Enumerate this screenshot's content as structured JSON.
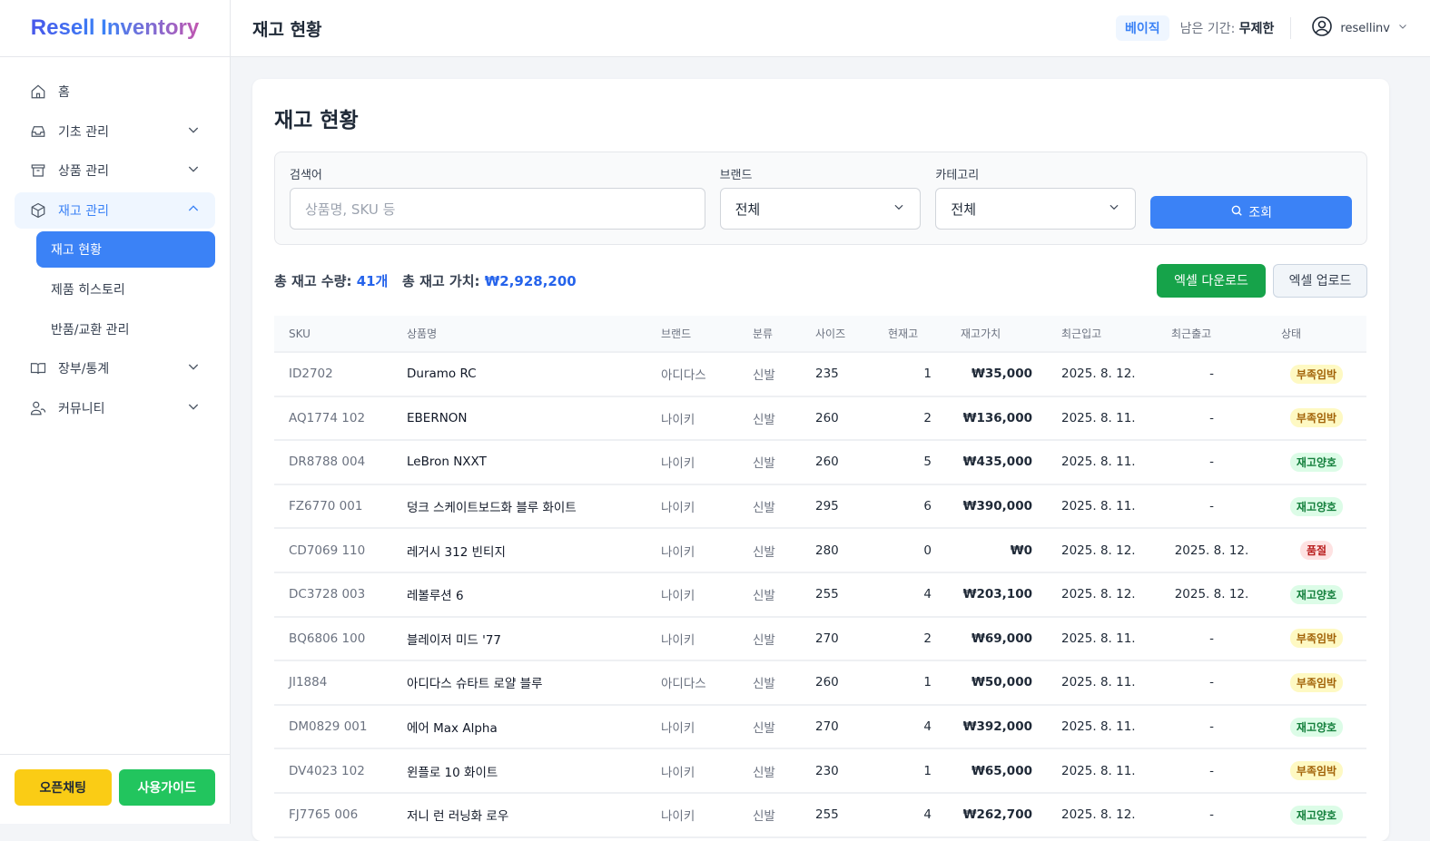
{
  "app": {
    "logo": "Resell Inventory"
  },
  "sidebar": {
    "items": [
      {
        "label": "홈",
        "icon": "home-icon"
      },
      {
        "label": "기초 관리",
        "icon": "inbox-icon"
      },
      {
        "label": "상품 관리",
        "icon": "archive-icon"
      },
      {
        "label": "재고 관리",
        "icon": "cube-icon"
      },
      {
        "label": "장부/통계",
        "icon": "book-icon"
      },
      {
        "label": "커뮤니티",
        "icon": "community-icon"
      }
    ],
    "subitems": [
      {
        "label": "재고 현황"
      },
      {
        "label": "제품 히스토리"
      },
      {
        "label": "반품/교환 관리"
      }
    ],
    "open_chat": "오픈채팅",
    "guide": "사용가이드"
  },
  "header": {
    "title": "재고 현황",
    "plan": "베이직",
    "remain_label": "남은 기간:",
    "remain_value": "무제한",
    "username": "resellinv"
  },
  "page": {
    "title": "재고 현황"
  },
  "filters": {
    "search_label": "검색어",
    "search_placeholder": "상품명, SKU 등",
    "brand_label": "브랜드",
    "brand_value": "전체",
    "category_label": "카테고리",
    "category_value": "전체",
    "search_button": "조회"
  },
  "summary": {
    "qty_label": "총 재고 수량:",
    "qty_value": "41개",
    "value_label": "총 재고 가치:",
    "value_value": "₩2,928,200",
    "download": "엑셀 다운로드",
    "upload": "엑셀 업로드"
  },
  "colors": {
    "primary": "#3b82f6",
    "green": "#16a34a",
    "warn_bg": "#fef9c3",
    "warn_fg": "#a16207",
    "ok_bg": "#dcfce7",
    "ok_fg": "#15803d",
    "out_bg": "#fee2e2",
    "out_fg": "#b91c1c"
  },
  "table": {
    "columns": [
      "SKU",
      "상품명",
      "브랜드",
      "분류",
      "사이즈",
      "현재고",
      "재고가치",
      "최근입고",
      "최근출고",
      "상태"
    ],
    "rows": [
      [
        "ID2702",
        "Duramo RC",
        "아디다스",
        "신발",
        "235",
        "1",
        "₩35,000",
        "2025. 8. 12.",
        "-",
        "부족임박"
      ],
      [
        "AQ1774 102",
        "EBERNON",
        "나이키",
        "신발",
        "260",
        "2",
        "₩136,000",
        "2025. 8. 11.",
        "-",
        "부족임박"
      ],
      [
        "DR8788 004",
        "LeBron NXXT",
        "나이키",
        "신발",
        "260",
        "5",
        "₩435,000",
        "2025. 8. 11.",
        "-",
        "재고양호"
      ],
      [
        "FZ6770 001",
        "덩크 스케이트보드화 블루 화이트",
        "나이키",
        "신발",
        "295",
        "6",
        "₩390,000",
        "2025. 8. 11.",
        "-",
        "재고양호"
      ],
      [
        "CD7069 110",
        "레거시 312 빈티지",
        "나이키",
        "신발",
        "280",
        "0",
        "₩0",
        "2025. 8. 12.",
        "2025. 8. 12.",
        "품절"
      ],
      [
        "DC3728 003",
        "레볼루션 6",
        "나이키",
        "신발",
        "255",
        "4",
        "₩203,100",
        "2025. 8. 12.",
        "2025. 8. 12.",
        "재고양호"
      ],
      [
        "BQ6806 100",
        "블레이저 미드 '77",
        "나이키",
        "신발",
        "270",
        "2",
        "₩69,000",
        "2025. 8. 11.",
        "-",
        "부족임박"
      ],
      [
        "JI1884",
        "아디다스 슈타트 로얄 블루",
        "아디다스",
        "신발",
        "260",
        "1",
        "₩50,000",
        "2025. 8. 11.",
        "-",
        "부족임박"
      ],
      [
        "DM0829 001",
        "에어 Max Alpha",
        "나이키",
        "신발",
        "270",
        "4",
        "₩392,000",
        "2025. 8. 11.",
        "-",
        "재고양호"
      ],
      [
        "DV4023 102",
        "윈플로 10 화이트",
        "나이키",
        "신발",
        "230",
        "1",
        "₩65,000",
        "2025. 8. 11.",
        "-",
        "부족임박"
      ],
      [
        "FJ7765 006",
        "저니 런 러닝화 로우",
        "나이키",
        "신발",
        "255",
        "4",
        "₩262,700",
        "2025. 8. 12.",
        "-",
        "재고양호"
      ]
    ]
  }
}
